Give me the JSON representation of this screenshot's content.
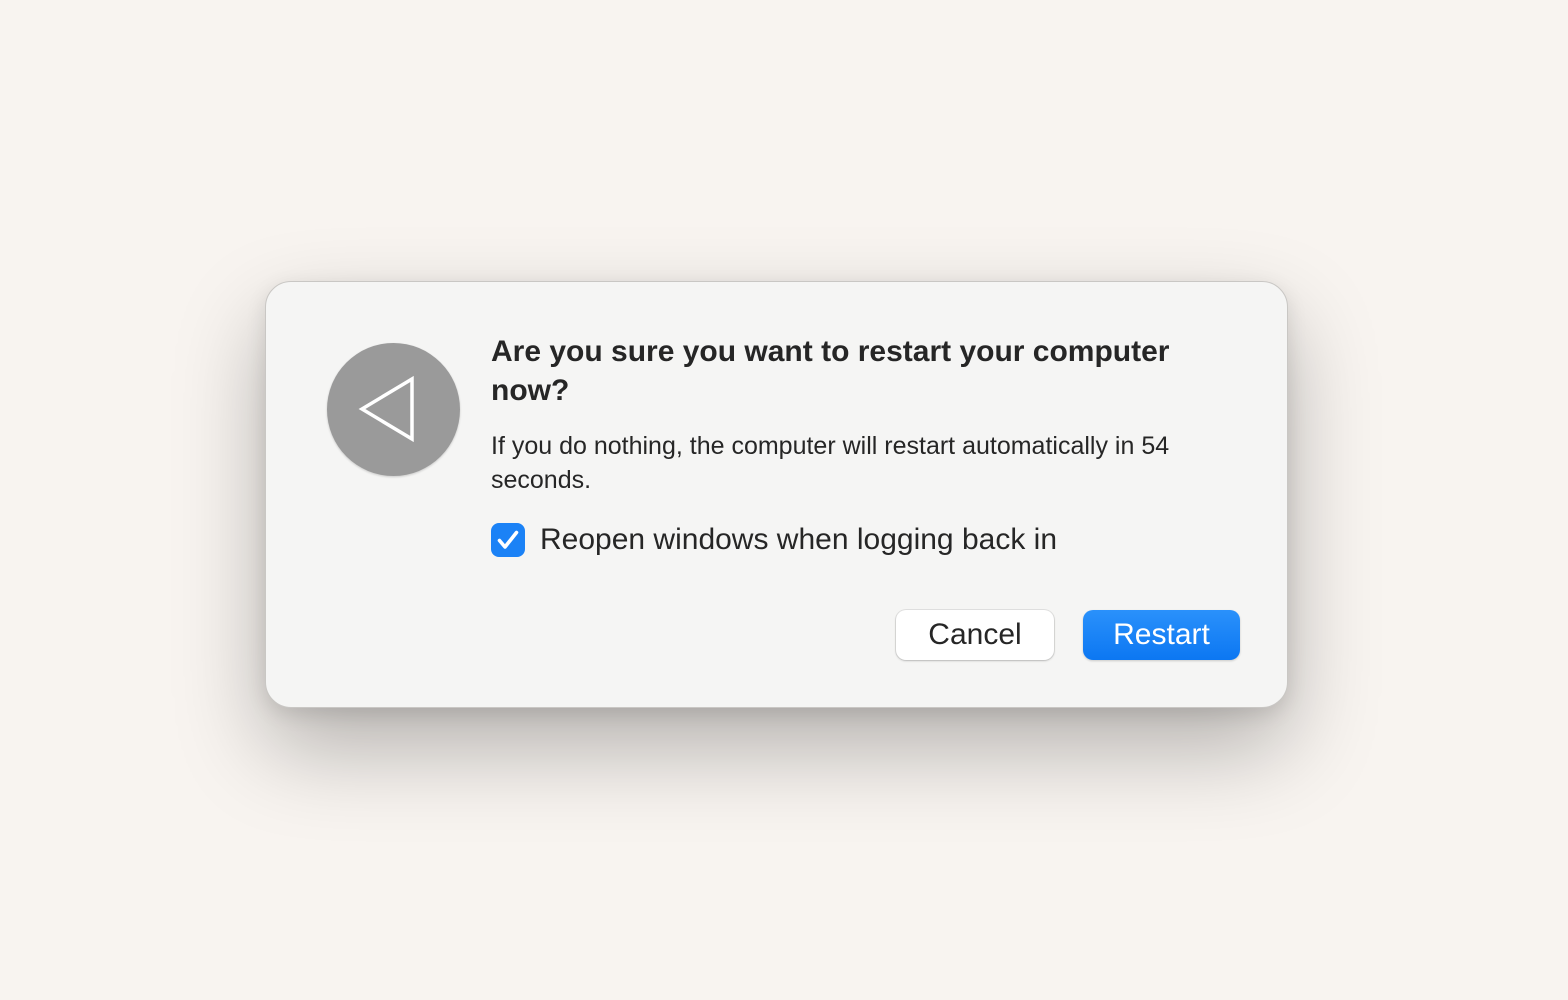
{
  "dialog": {
    "icon": "restart-arrow-icon",
    "title": "Are you sure you want to restart your computer now?",
    "message": "If you do nothing, the computer will restart automatically in 54 seconds.",
    "checkbox": {
      "label": "Reopen windows when logging back in",
      "checked": true
    },
    "buttons": {
      "cancel_label": "Cancel",
      "restart_label": "Restart"
    }
  },
  "colors": {
    "background": "#f8f4f0",
    "dialog": "#f5f5f4",
    "accent": "#1b82f6",
    "icon_circle": "#9a9a9a"
  }
}
